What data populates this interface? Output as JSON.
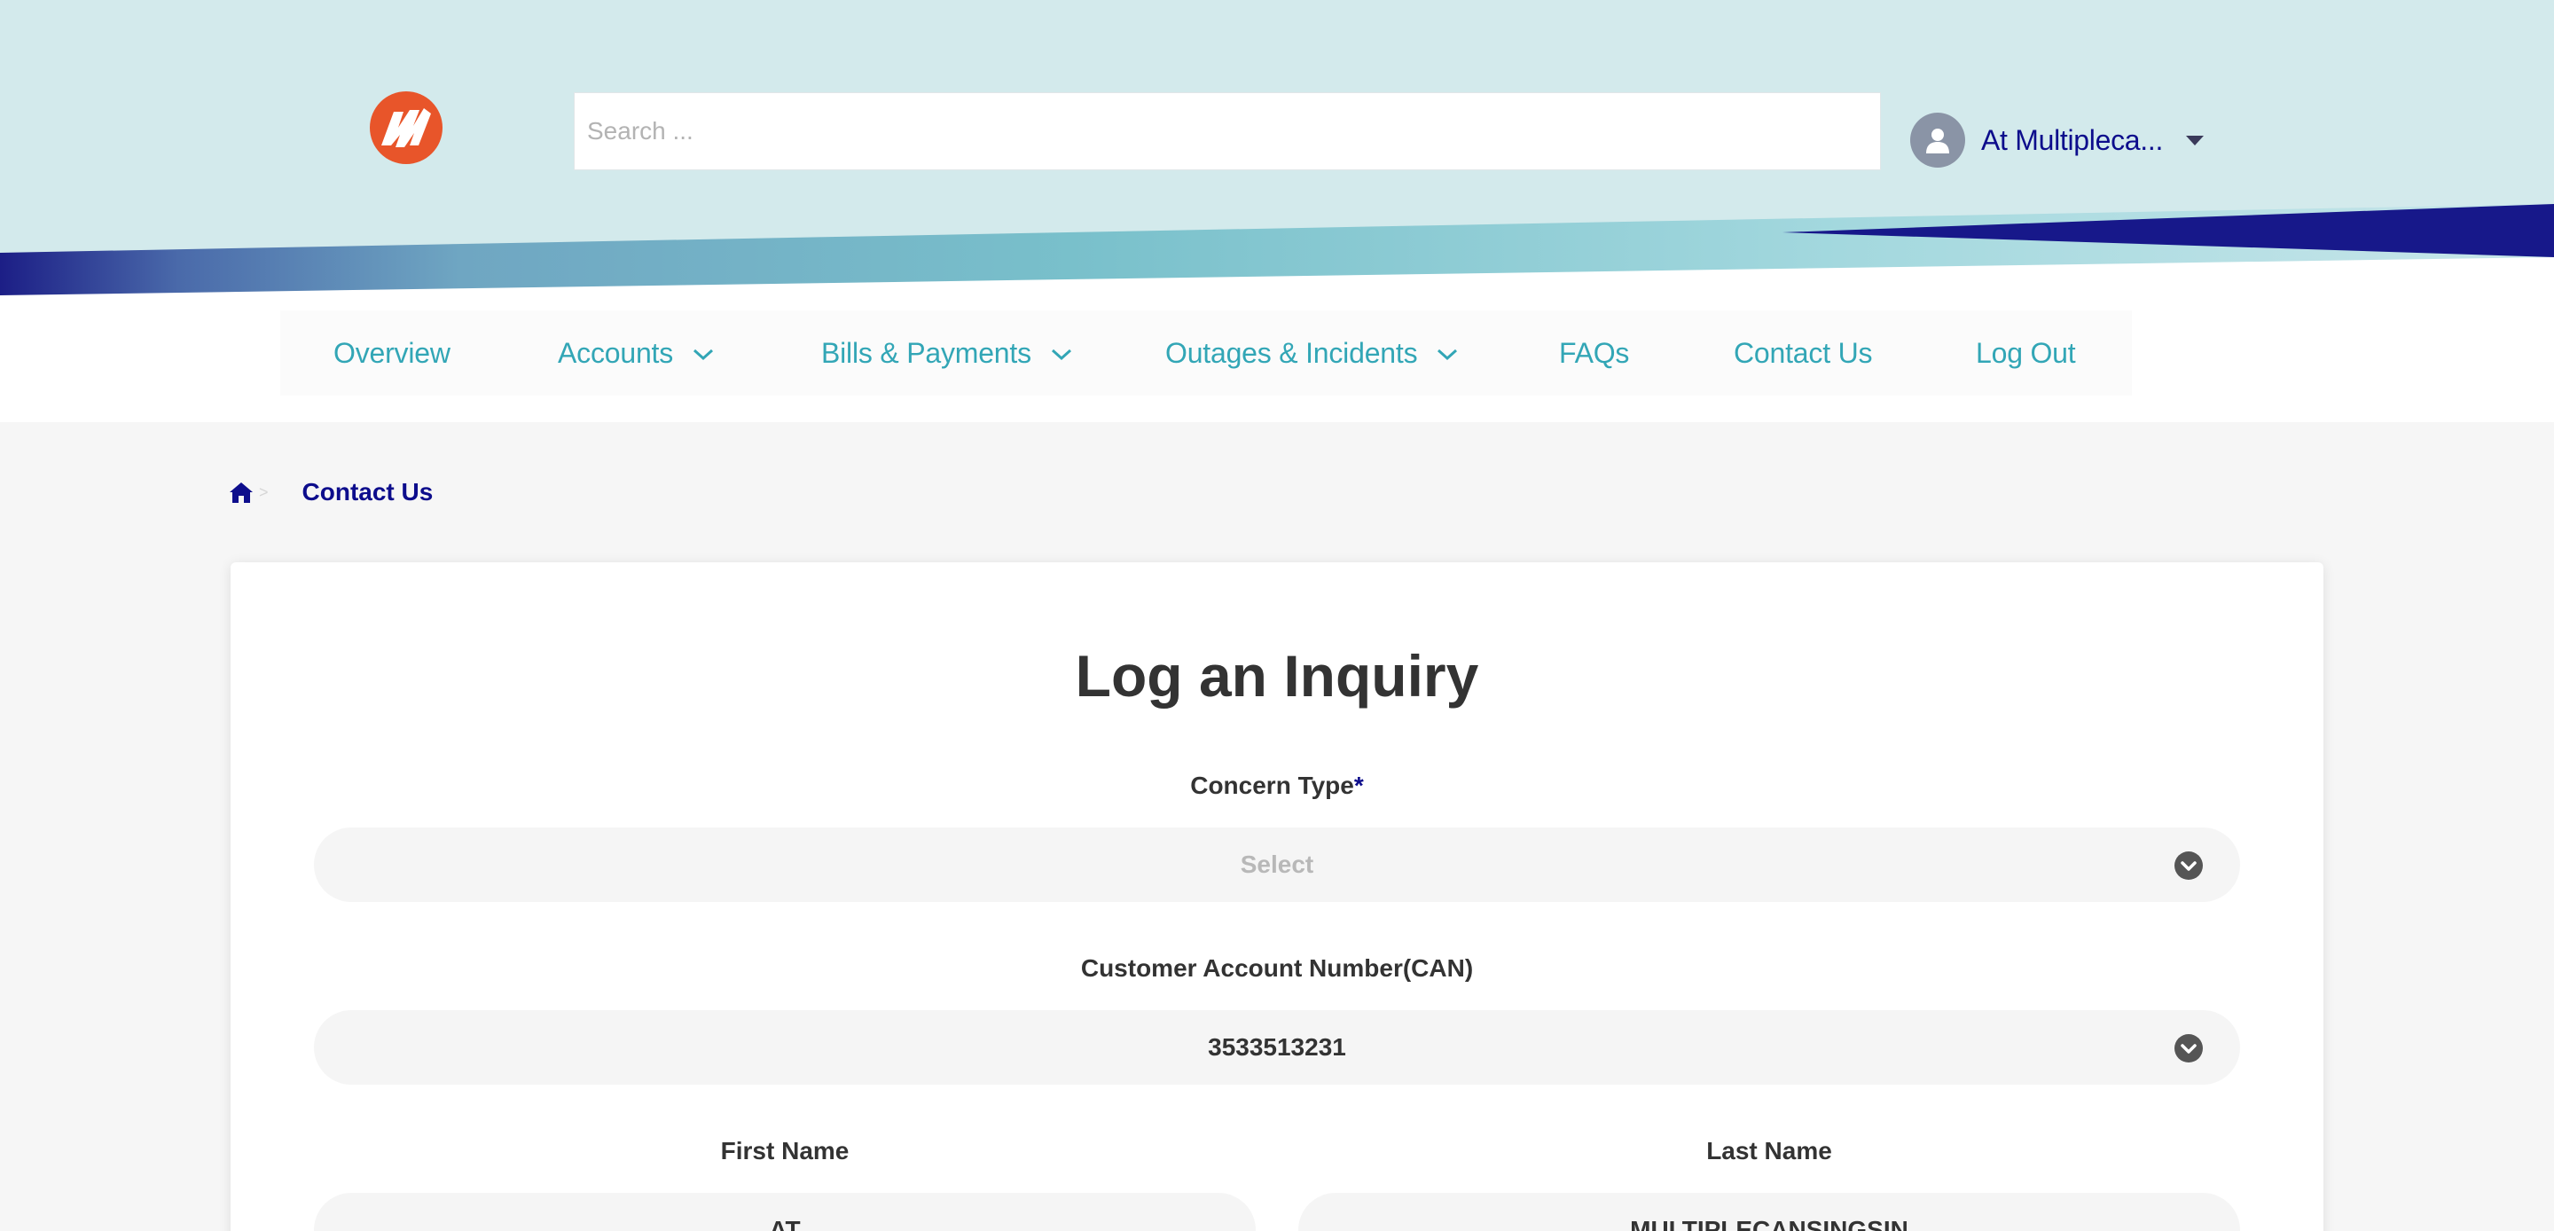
{
  "header": {
    "search_placeholder": "Search ...",
    "user_name": "At Multipleca..."
  },
  "nav": {
    "items": [
      {
        "label": "Overview",
        "has_dropdown": false
      },
      {
        "label": "Accounts",
        "has_dropdown": true
      },
      {
        "label": "Bills & Payments",
        "has_dropdown": true
      },
      {
        "label": "Outages & Incidents",
        "has_dropdown": true
      },
      {
        "label": "FAQs",
        "has_dropdown": false
      },
      {
        "label": "Contact Us",
        "has_dropdown": false
      },
      {
        "label": "Log Out",
        "has_dropdown": false
      }
    ]
  },
  "breadcrumb": {
    "separator": ">",
    "current": "Contact Us"
  },
  "form": {
    "title": "Log an Inquiry",
    "concern_type": {
      "label": "Concern Type",
      "required_mark": "*",
      "value": "Select"
    },
    "account_number": {
      "label": "Customer Account Number(CAN)",
      "value": "3533513231"
    },
    "first_name": {
      "label": "First Name",
      "value": "AT"
    },
    "last_name": {
      "label": "Last Name",
      "value": "MULTIPLECANSINGSIN"
    }
  },
  "colors": {
    "header_bg": "#d3eaec",
    "brand_navy": "#0d0d8c",
    "nav_teal": "#32a6b6",
    "logo_orange": "#e8552a"
  }
}
